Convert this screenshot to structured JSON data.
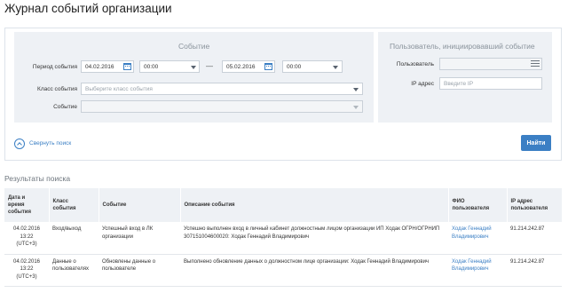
{
  "page": {
    "title": "Журнал событий организации"
  },
  "search": {
    "event_section_title": "Событие",
    "user_section_title": "Пользователь, инициировавший событие",
    "period_label": "Период события",
    "date_from": "04.02.2016",
    "time_from": "00:00",
    "period_dash": "—",
    "date_to": "05.02.2016",
    "time_to": "00:00",
    "class_label": "Класс события",
    "class_placeholder": "Выберите класс события",
    "event_label": "Событие",
    "user_label": "Пользователь",
    "ip_label": "IP адрес",
    "ip_placeholder": "Введите IP",
    "collapse_label": "Свернуть поиск",
    "find_button": "Найти"
  },
  "results": {
    "title": "Результаты поиска",
    "columns": {
      "datetime": [
        "Дата и",
        "время",
        "события"
      ],
      "class": [
        "Класс",
        "события"
      ],
      "event": "Событие",
      "description": "Описание события",
      "fio": [
        "ФИО",
        "пользователя"
      ],
      "ip": [
        "IP адрес",
        "пользователя"
      ]
    },
    "rows": [
      {
        "date": "04.02.2016",
        "time": "13:22",
        "tz": "(UTC+3)",
        "class": "Вход/выход",
        "event": "Успешный вход в ЛК организации",
        "description": "Успешно выполнен вход в личный кабинет должностным лицом организации ИП Ходак ОГРН/ОГРНИП 307151004600020: Ходак Геннадий Владимирович",
        "fio": "Ходак Геннадий Владимирович",
        "ip": "91.214.242.87"
      },
      {
        "date": "04.02.2016",
        "time": "13:22",
        "tz": "(UTC+3)",
        "class": "Данные о пользователях",
        "event": "Обновлены данные о пользователе",
        "description": "Выполнено обновление данных о должностном лице организации: Ходак Геннадий Владимирович",
        "fio": "Ходак Геннадий Владимирович",
        "ip": "91.214.242.87"
      }
    ]
  },
  "colors": {
    "accent": "#3b7fc4",
    "panel_bg": "#eef1f5"
  }
}
